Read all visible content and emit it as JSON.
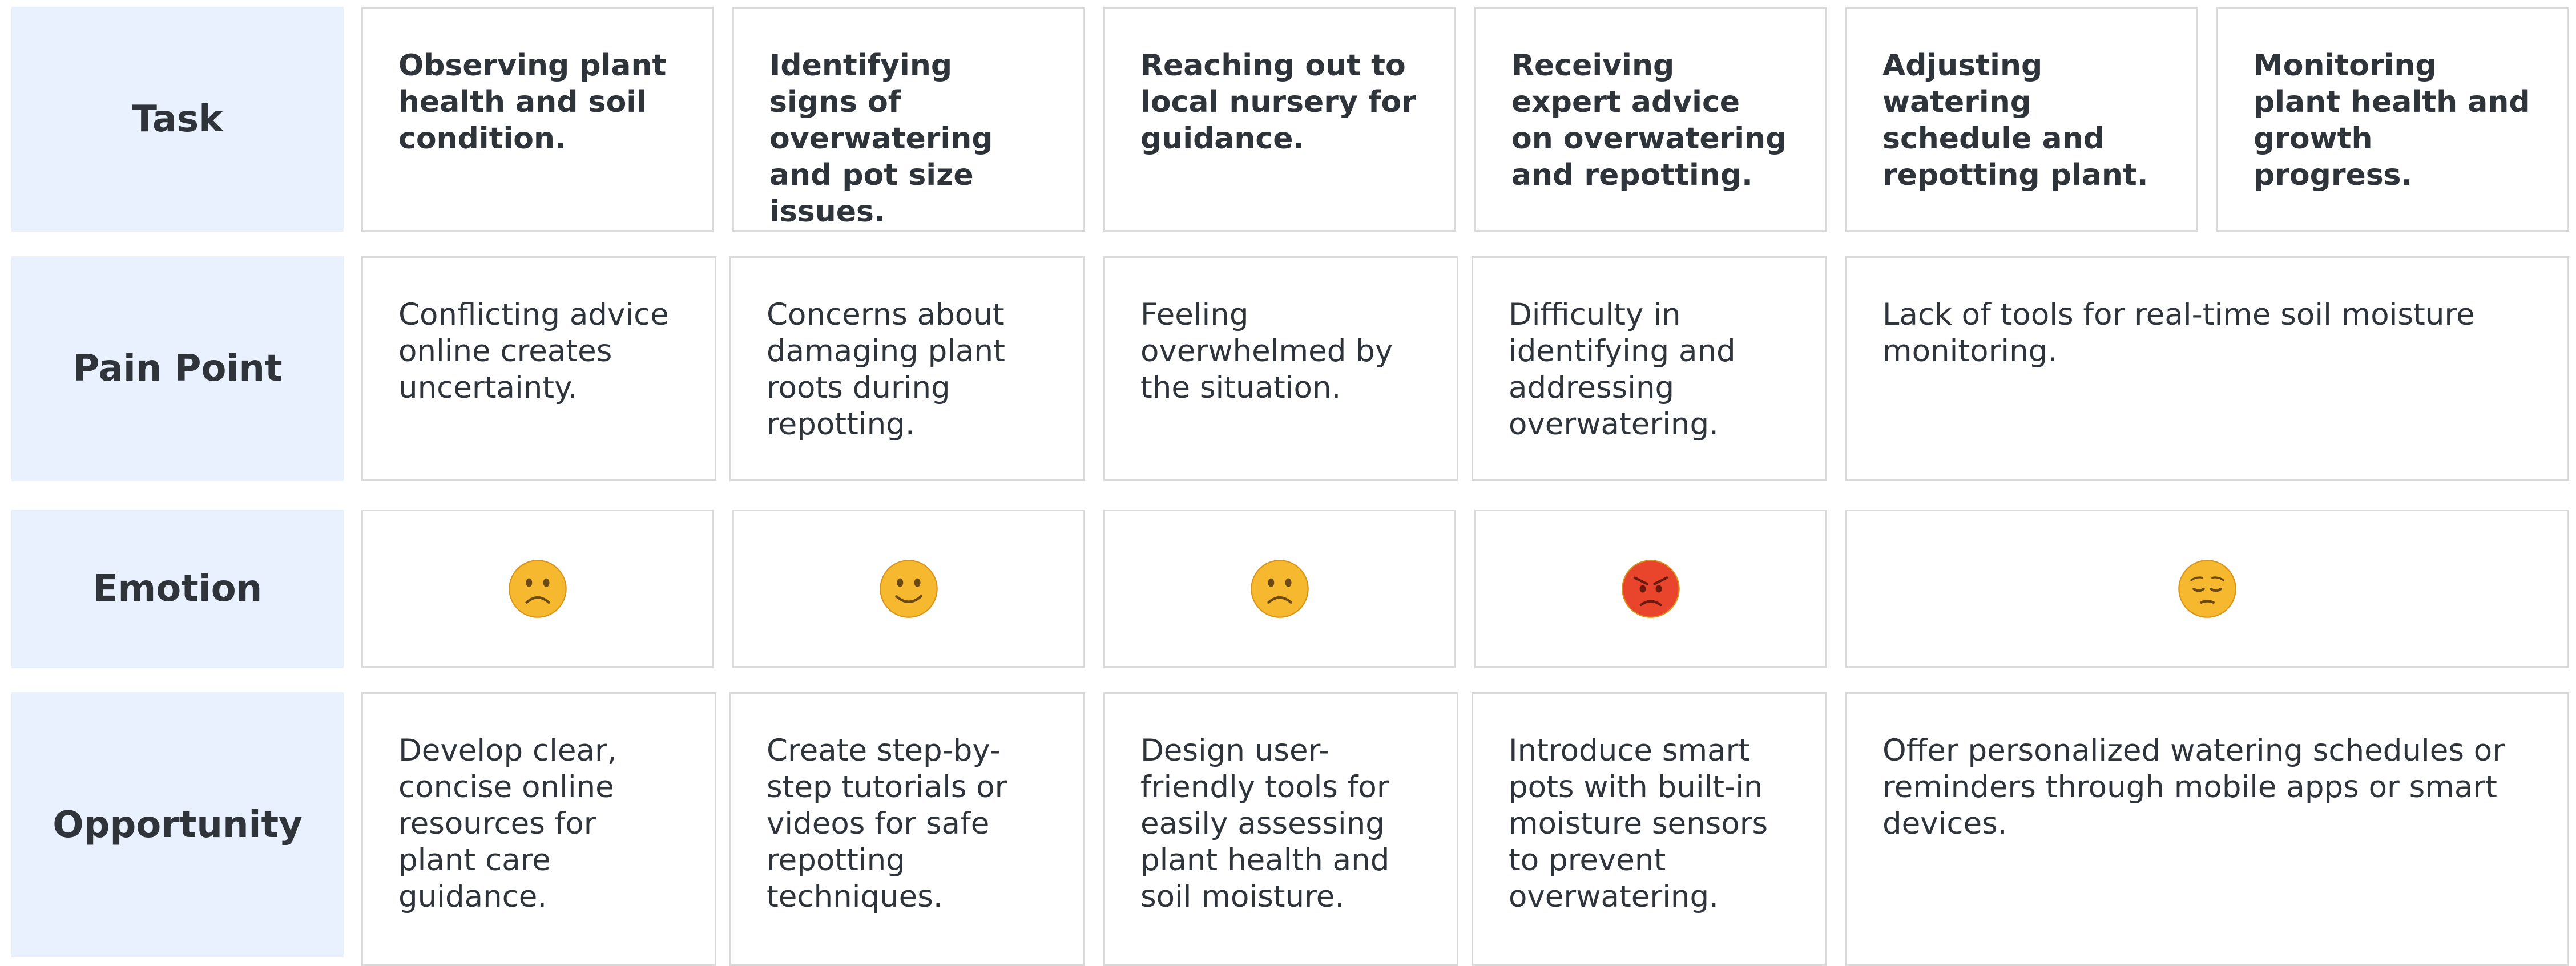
{
  "rows": [
    {
      "label": "Task"
    },
    {
      "label": "Pain Point"
    },
    {
      "label": "Emotion"
    },
    {
      "label": "Opportunity"
    }
  ],
  "tasks": [
    "Observing plant health and soil condition.",
    "Identifying signs of overwatering and pot size issues.",
    "Reaching out to local nursery for guidance.",
    "Receiving expert advice on overwatering and repotting.",
    "Adjusting watering schedule and repotting plant.",
    "Monitoring plant health and growth progress."
  ],
  "pain_points": [
    "Conflicting advice online creates uncertainty.",
    "Concerns about damaging plant roots during repotting.",
    "Feeling overwhelmed by the situation.",
    "Difficulty in identifying and addressing overwatering.",
    "Lack of tools for real-time soil moisture monitoring."
  ],
  "emotions": [
    {
      "icon": "frowning-face-icon",
      "kind": "frown",
      "color": "#f5b82e"
    },
    {
      "icon": "smiling-face-icon",
      "kind": "smile",
      "color": "#f5b82e"
    },
    {
      "icon": "frowning-face-icon",
      "kind": "frown",
      "color": "#f5b82e"
    },
    {
      "icon": "angry-face-icon",
      "kind": "angry",
      "color": "#e8452c"
    },
    {
      "icon": "pensive-face-icon",
      "kind": "pensive",
      "color": "#f5b82e"
    }
  ],
  "opportunities": [
    "Develop clear, concise online resources for plant care guidance.",
    "Create step-by-step tutorials or videos for safe repotting techniques.",
    "Design user-friendly tools for easily assessing plant health and soil moisture.",
    "Introduce smart pots with built-in moisture sensors to prevent overwatering.",
    "Offer personalized watering schedules or reminders through mobile apps or smart devices."
  ]
}
